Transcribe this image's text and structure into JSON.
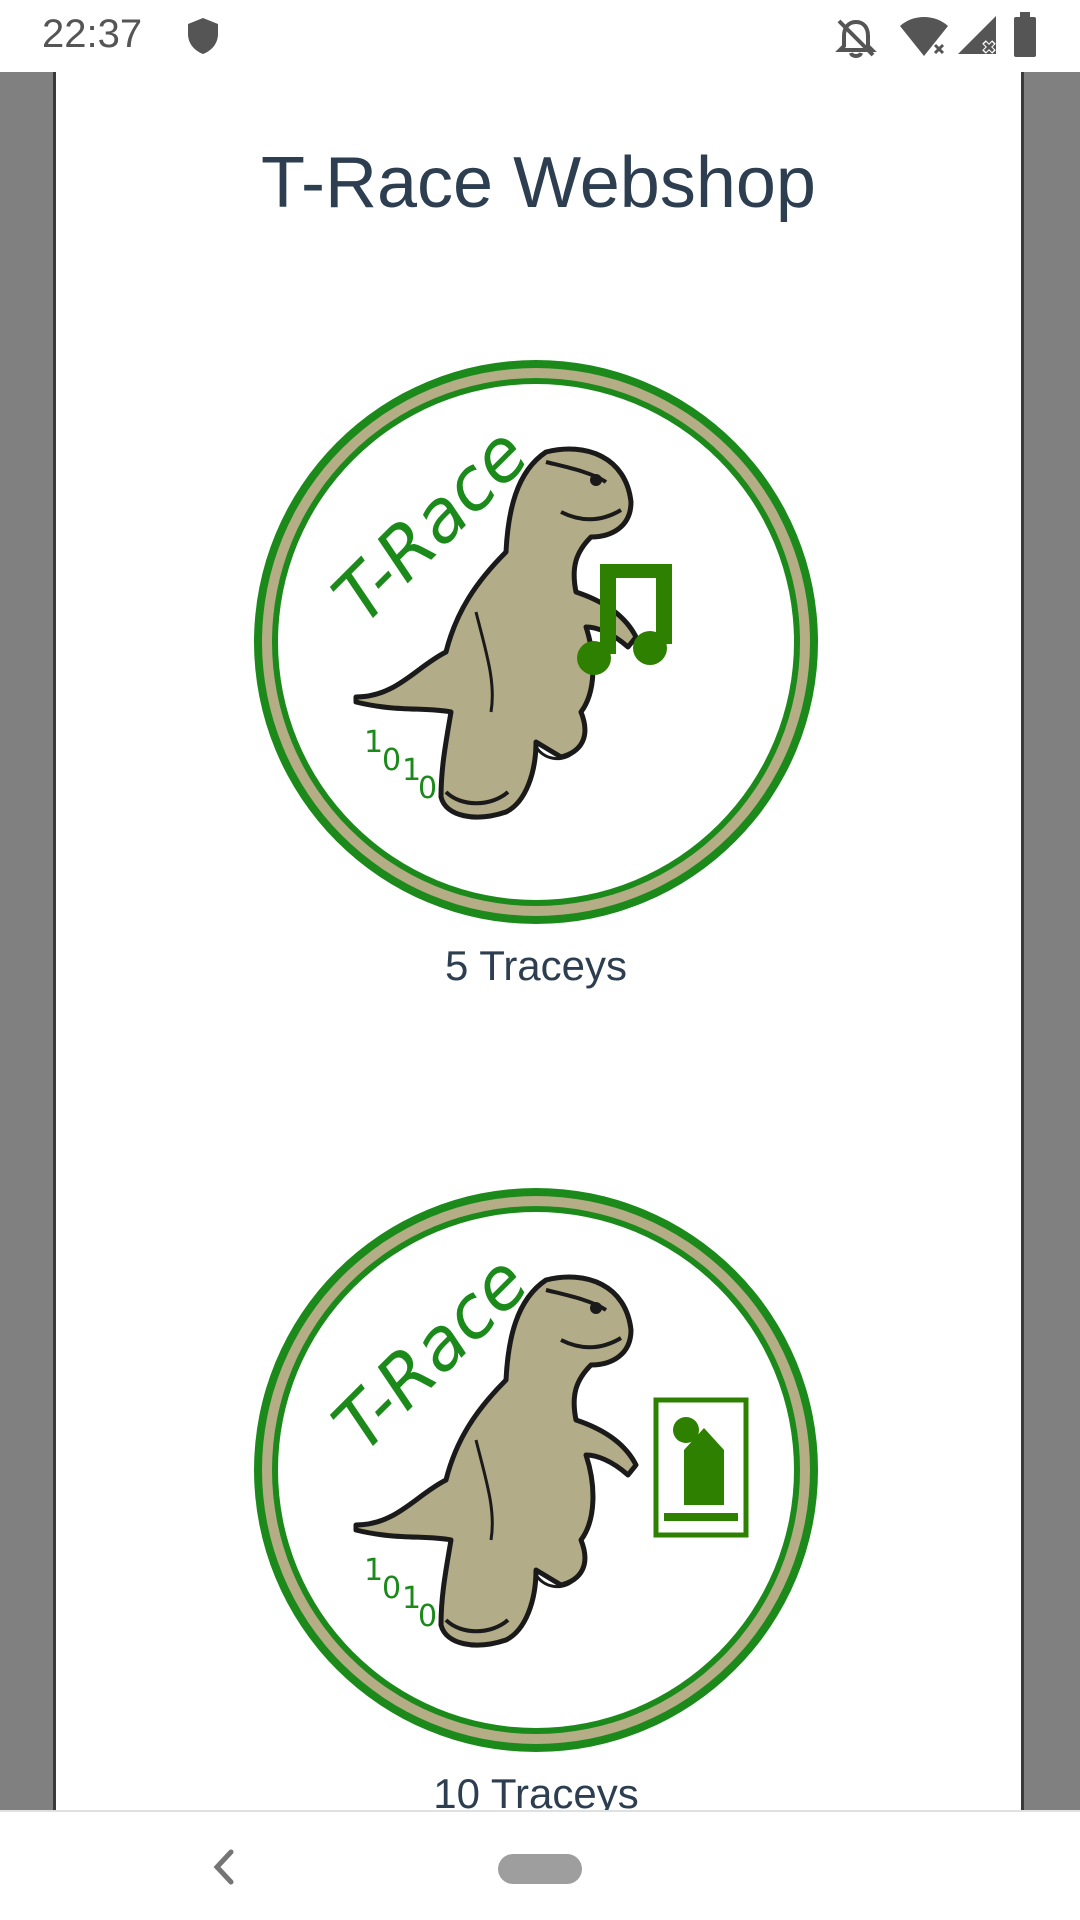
{
  "status_bar": {
    "time": "22:37",
    "icons": [
      "shield-icon",
      "bell-off-icon",
      "wifi-icon",
      "signal-icon",
      "battery-icon"
    ]
  },
  "page": {
    "title": "T-Race Webshop"
  },
  "products": [
    {
      "label": "5 Traceys",
      "badge_text": "T-Race",
      "binary_digits": [
        "1",
        "0",
        "1",
        "0"
      ],
      "symbol": "music-note-icon"
    },
    {
      "label": "10 Traceys",
      "badge_text": "T-Race",
      "binary_digits": [
        "1",
        "0",
        "1",
        "0"
      ],
      "symbol": "portrait-frame-icon"
    }
  ],
  "colors": {
    "title": "#2c3e50",
    "badge_green": "#1b8a1b",
    "badge_tan": "#b5ad86",
    "dino": "#b3ac88",
    "frame_gray": "#808080"
  },
  "nav_bar": {
    "icons": [
      "back-icon",
      "home-pill"
    ]
  }
}
